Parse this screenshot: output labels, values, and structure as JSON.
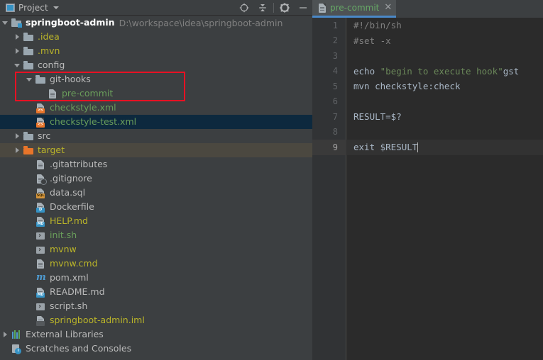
{
  "panel": {
    "title": "Project",
    "dropdown_icon": "chevron-down-icon",
    "toolbar": [
      {
        "name": "locate-icon",
        "tooltip": "Select Opened File"
      },
      {
        "name": "collapse-all-icon",
        "tooltip": "Collapse All"
      },
      {
        "name": "gear-icon",
        "tooltip": "Settings"
      },
      {
        "name": "minimize-icon",
        "tooltip": "Hide"
      }
    ]
  },
  "tree": {
    "root": {
      "label": "springboot-admin",
      "path": "D:\\workspace\\idea\\springboot-admin"
    },
    "items": [
      {
        "label": ".idea",
        "indent": 1,
        "icon": "folder-icon",
        "color": "#BBB529",
        "arrow": "closed",
        "state": "normal"
      },
      {
        "label": ".mvn",
        "indent": 1,
        "icon": "folder-icon",
        "color": "#BBB529",
        "arrow": "closed",
        "state": "normal"
      },
      {
        "label": "config",
        "indent": 1,
        "icon": "folder-icon",
        "color": "#BBBBBB",
        "arrow": "open",
        "state": "normal"
      },
      {
        "label": "git-hooks",
        "indent": 2,
        "icon": "folder-icon",
        "color": "#BBBBBB",
        "arrow": "open",
        "state": "normal"
      },
      {
        "label": "pre-commit",
        "indent": 3,
        "icon": "file-icon",
        "color": "#6A9E5B",
        "arrow": "none",
        "state": "normal"
      },
      {
        "label": "checkstyle.xml",
        "indent": 2,
        "icon": "xml-file-icon",
        "color": "#6A9E5B",
        "arrow": "none",
        "state": "normal"
      },
      {
        "label": "checkstyle-test.xml",
        "indent": 2,
        "icon": "xml-file-icon",
        "color": "#6A9E5B",
        "arrow": "none",
        "state": "selected"
      },
      {
        "label": "src",
        "indent": 1,
        "icon": "folder-icon",
        "color": "#BBBBBB",
        "arrow": "closed",
        "state": "hover"
      },
      {
        "label": "target",
        "indent": 1,
        "icon": "folder-icon",
        "color": "#BBB529",
        "arrow": "closed",
        "state": "excluded"
      },
      {
        "label": ".gitattributes",
        "indent": 2,
        "icon": "file-icon",
        "color": "#BBBBBB",
        "arrow": "none",
        "state": "normal"
      },
      {
        "label": ".gitignore",
        "indent": 2,
        "icon": "ignored-file-icon",
        "color": "#BBBBBB",
        "arrow": "none",
        "state": "normal"
      },
      {
        "label": "data.sql",
        "indent": 2,
        "icon": "sql-file-icon",
        "color": "#BBBBBB",
        "arrow": "none",
        "state": "normal"
      },
      {
        "label": "Dockerfile",
        "indent": 2,
        "icon": "docker-file-icon",
        "color": "#BBBBBB",
        "arrow": "none",
        "state": "normal"
      },
      {
        "label": "HELP.md",
        "indent": 2,
        "icon": "markdown-file-icon",
        "color": "#BBB529",
        "arrow": "none",
        "state": "normal"
      },
      {
        "label": "init.sh",
        "indent": 2,
        "icon": "shell-script-icon",
        "color": "#6A9E5B",
        "arrow": "none",
        "state": "normal"
      },
      {
        "label": "mvnw",
        "indent": 2,
        "icon": "shell-script-icon",
        "color": "#BBB529",
        "arrow": "none",
        "state": "normal"
      },
      {
        "label": "mvnw.cmd",
        "indent": 2,
        "icon": "file-icon",
        "color": "#BBB529",
        "arrow": "none",
        "state": "normal"
      },
      {
        "label": "pom.xml",
        "indent": 2,
        "icon": "maven-file-icon",
        "color": "#BBBBBB",
        "arrow": "none",
        "state": "normal"
      },
      {
        "label": "README.md",
        "indent": 2,
        "icon": "markdown-file-icon",
        "color": "#BBBBBB",
        "arrow": "none",
        "state": "normal"
      },
      {
        "label": "script.sh",
        "indent": 2,
        "icon": "shell-script-icon",
        "color": "#BBBBBB",
        "arrow": "none",
        "state": "normal"
      },
      {
        "label": "springboot-admin.iml",
        "indent": 2,
        "icon": "iml-file-icon",
        "color": "#BBB529",
        "arrow": "none",
        "state": "normal"
      },
      {
        "label": "External Libraries",
        "indent": 0,
        "icon": "libraries-icon",
        "color": "#BBBBBB",
        "arrow": "closed",
        "state": "normal"
      },
      {
        "label": "Scratches and Consoles",
        "indent": 0,
        "icon": "scratches-icon",
        "color": "#BBBBBB",
        "arrow": "none",
        "state": "normal"
      }
    ]
  },
  "annotation": {
    "name": "red-highlight-box",
    "color": "#E81123"
  },
  "editor": {
    "tab": {
      "label": "pre-commit",
      "icon": "file-icon",
      "close_icon": "close-icon",
      "accent_color": "#4A88C7",
      "active": true
    },
    "lines": [
      {
        "n": "1",
        "text": "#!/bin/sh",
        "kind": "comment",
        "current": false
      },
      {
        "n": "2",
        "text": "#set -x",
        "kind": "comment",
        "current": false
      },
      {
        "n": "3",
        "text": "",
        "kind": "plain",
        "current": false
      },
      {
        "n": "4",
        "text": "echo \"begin to execute hook\"gst",
        "kind": "echo",
        "current": false
      },
      {
        "n": "5",
        "text": "mvn checkstyle:check",
        "kind": "plain",
        "current": false
      },
      {
        "n": "6",
        "text": "",
        "kind": "plain",
        "current": false
      },
      {
        "n": "7",
        "text": "RESULT=$?",
        "kind": "plain",
        "current": false
      },
      {
        "n": "8",
        "text": "",
        "kind": "plain",
        "current": false
      },
      {
        "n": "9",
        "text": "exit $RESULT",
        "kind": "plain",
        "current": true
      }
    ],
    "echo_line": {
      "cmd": "echo ",
      "string": "\"begin to execute hook\"",
      "tail": "gst"
    }
  },
  "colors": {
    "panel_bg": "#3C3F41",
    "editor_bg": "#2B2B2B",
    "gutter_bg": "#313335",
    "selection": "#0D293E",
    "excluded_row": "#4B4840",
    "text": "#BBBBBB",
    "code_text": "#A9B7C6",
    "comment": "#808080",
    "string": "#6A8759",
    "accent": "#4A88C7"
  }
}
